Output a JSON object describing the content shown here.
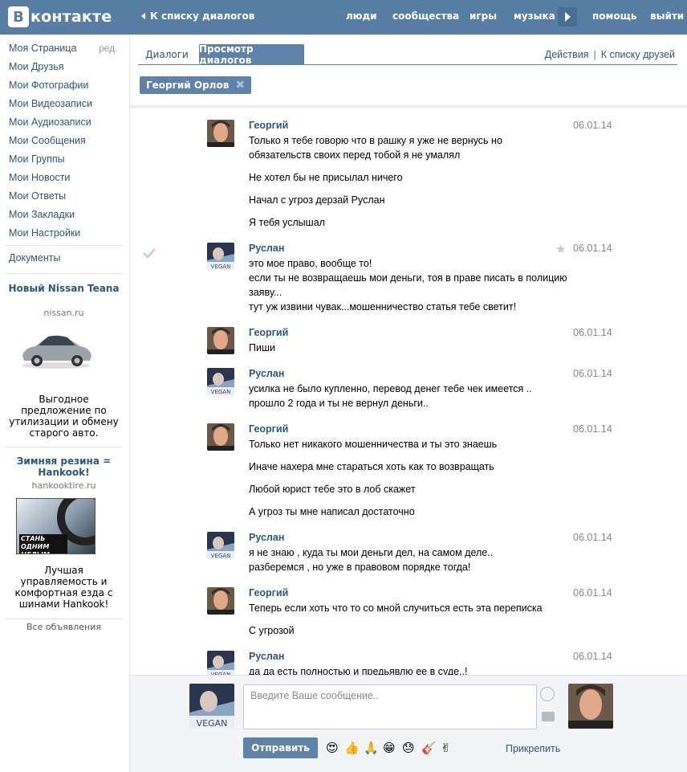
{
  "topbar": {
    "logo_letter": "В",
    "logo_text": "контакте",
    "back_label": "К списку диалогов",
    "nav": [
      "люди",
      "сообщества",
      "игры",
      "музыка",
      "помощь",
      "выйти"
    ]
  },
  "sidebar": {
    "items": [
      "Моя Страница",
      "Мои Друзья",
      "Мои Фотографии",
      "Мои Видеозаписи",
      "Мои Аудиозаписи",
      "Мои Сообщения",
      "Мои Группы",
      "Мои Новости",
      "Мои Ответы",
      "Мои Закладки",
      "Мои Настройки"
    ],
    "edit_label": "ред.",
    "documents_label": "Документы",
    "ads": [
      {
        "title": "Новый Nissan Teana",
        "domain": "nissan.ru",
        "text": "Выгодное предложение по утилизации и обмену старого авто."
      },
      {
        "title": "Зимняя резина = Hankook!",
        "domain": "hankooktire.ru",
        "text": "Лучшая управляемость и комфортная езда с шинами Hankook!",
        "image_caption": "СТАНЬ ОДНИМ ЦЕЛЫМ"
      }
    ],
    "all_ads_label": "Все объявления"
  },
  "main": {
    "tabs": [
      "Диалоги",
      "Просмотр диалогов"
    ],
    "links": [
      "Действия",
      "К списку друзей"
    ],
    "chip_label": "Георгий Орлов"
  },
  "messages": [
    {
      "author": "Георгий",
      "date": "06.01.14",
      "lines": [
        "Только я тебе говорю что в рашку я уже не вернусь но",
        "обязательств своих перед тобой я не умалял",
        "Не хотел бы не присылал ничего",
        "Начал с угроз дерзай Руслан",
        "Я тебя услышал"
      ]
    },
    {
      "author": "Руслан",
      "date": "06.01.14",
      "lines": [
        "это мое право, вообще то!",
        "если ты не возвращаешь мои деньги, тоя в праве писать в полицию",
        "заяву...",
        "тут уж извини чувак...мошенничество статья тебе светит!"
      ]
    },
    {
      "author": "Георгий",
      "date": "06.01.14",
      "lines": [
        "Пиши"
      ]
    },
    {
      "author": "Руслан",
      "date": "06.01.14",
      "lines": [
        "усилка не было купленно, перевод денег тебе чек имеется ..",
        "прошло 2 года и ты не вернул деньги.."
      ]
    },
    {
      "author": "Георгий",
      "date": "06.01.14",
      "lines": [
        "Только нет никакого мошенничества и ты это знаешь",
        "Иначе нахера мне стараться хоть как то возвращать",
        "Любой юрист тебе это в лоб скажет",
        "А угроз ты мне написал достаточно"
      ]
    },
    {
      "author": "Руслан",
      "date": "06.01.14",
      "lines": [
        "я не знаю , куда ты мои деньги дел, на самом деле..",
        "разберемся , но уже в правовом порядке тогда!"
      ]
    },
    {
      "author": "Георгий",
      "date": "06.01.14",
      "lines": [
        "Теперь если хоть что то со мной случиться есть эта переписка",
        "С угрозой"
      ]
    },
    {
      "author": "Руслан",
      "date": "06.01.14",
      "lines": [
        "да да есть полностью и предьявлю ее в суде..!"
      ]
    }
  ],
  "composer": {
    "placeholder": "Введите Ваше сообщение..",
    "send_label": "Отправить",
    "attach_label": "Прикрепить",
    "emojis": [
      "😍",
      "👍",
      "🙏",
      "😁",
      "😓",
      "🎸",
      "✌"
    ]
  },
  "avatar_badge": "VEGAN",
  "colors": {
    "brand": "#587ea3",
    "link": "#2b587a",
    "button": "#5e82a8",
    "muted": "#888888"
  }
}
